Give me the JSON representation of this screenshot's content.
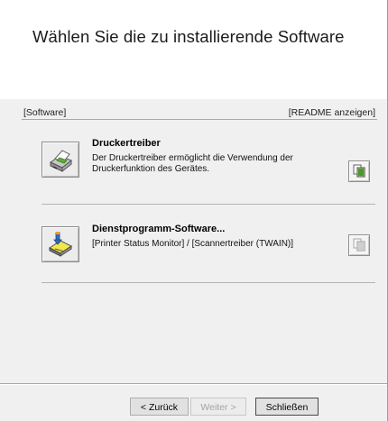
{
  "header": {
    "title": "Wählen Sie die zu installierende Software"
  },
  "section": {
    "left_label": "[Software]",
    "right_label": "[README anzeigen]"
  },
  "items": [
    {
      "title": "Druckertreiber",
      "description": "Der Druckertreiber ermöglicht die Verwendung der Druckerfunktion des Gerätes.",
      "icon": "printer-driver-icon",
      "readme_icon": "readme-document-icon"
    },
    {
      "title": "Dienstprogramm-Software...",
      "description": "[Printer Status Monitor] / [Scannertreiber (TWAIN)]",
      "icon": "utility-software-icon",
      "readme_icon": "readme-document-icon"
    }
  ],
  "buttons": {
    "back": "< Zurück",
    "next": "Weiter >",
    "close": "Schließen"
  }
}
